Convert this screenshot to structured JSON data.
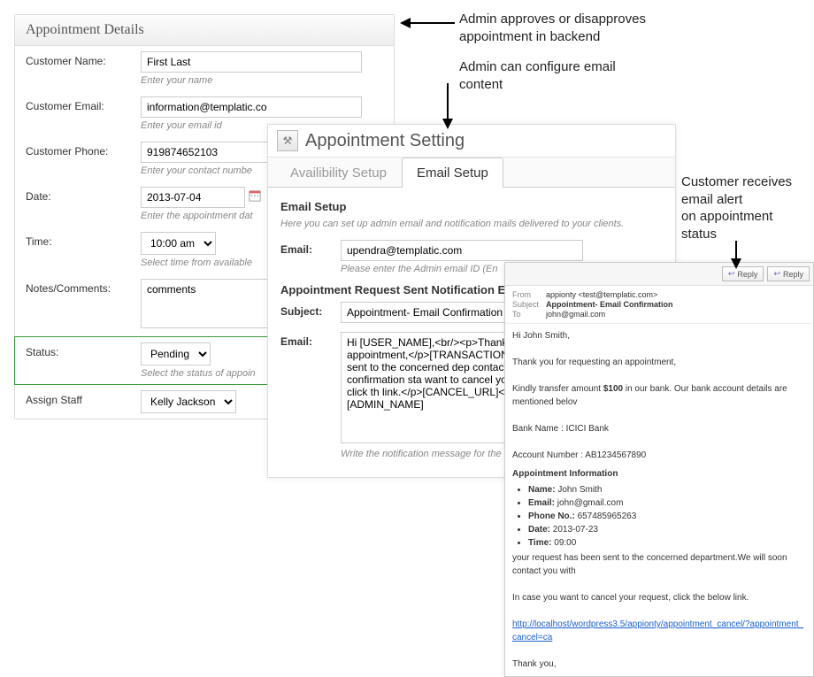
{
  "details": {
    "title": "Appointment Details",
    "customerName": {
      "label": "Customer Name:",
      "value": "First Last",
      "hint": "Enter your name"
    },
    "customerEmail": {
      "label": "Customer Email:",
      "value": "information@templatic.co",
      "hint": "Enter your email id"
    },
    "customerPhone": {
      "label": "Customer Phone:",
      "value": "919874652103",
      "hint": "Enter your contact numbe"
    },
    "date": {
      "label": "Date:",
      "value": "2013-07-04",
      "hint": "Enter the appointment dat"
    },
    "time": {
      "label": "Time:",
      "value": "10:00 am",
      "hint": "Select time from available"
    },
    "notes": {
      "label": "Notes/Comments:",
      "value": "comments"
    },
    "status": {
      "label": "Status:",
      "value": "Pending",
      "hint": "Select the status of appoin"
    },
    "assignStaff": {
      "label": "Assign Staff",
      "value": "Kelly Jackson"
    }
  },
  "settings": {
    "title": "Appointment Setting",
    "tabs": {
      "availability": "Availibility Setup",
      "email": "Email Setup"
    },
    "sectionTitle": "Email Setup",
    "sectionDesc": "Here you can set up admin email and notification mails delivered to your clients.",
    "email": {
      "label": "Email:",
      "value": "upendra@templatic.com",
      "hint": "Please enter the Admin email ID (En"
    },
    "requestHeading": "Appointment Request Sent Notification Email",
    "subject": {
      "label": "Subject:",
      "value": "Appointment- Email Confirmation"
    },
    "body": {
      "label": "Email:",
      "value": "Hi [USER_NAME],<br/><p>Thank yo appointment,</p>[TRANSACTION_D has been sent to the concerned dep contact you with the confirmation sta want to cancel your request, click th link.</p>[CANCEL_URL]<br/><br/>T [ADMIN_NAME]",
      "hint": "Write the notification message for the"
    }
  },
  "emailPreview": {
    "replyBtn": "Reply",
    "from": {
      "k": "From",
      "v": "appionty <test@templatic.com>"
    },
    "subject": {
      "k": "Subject",
      "v": "Appointment- Email Confirmation"
    },
    "to": {
      "k": "To",
      "v": "john@gmail.com"
    },
    "greeting": "Hi John Smith,",
    "l1": "Thank you for requesting an appointment,",
    "l2a": "Kindly transfer amount ",
    "amount": "$100",
    "l2b": " in our bank. Our bank account details are mentioned belov",
    "bank": "Bank Name : ICICI Bank",
    "account": "Account Number : AB1234567890",
    "infoTitle": "Appointment Information",
    "info": {
      "name": {
        "k": "Name:",
        "v": "John Smith"
      },
      "email": {
        "k": "Email:",
        "v": "john@gmail.com"
      },
      "phone": {
        "k": "Phone No.:",
        "v": "657485965263"
      },
      "date": {
        "k": "Date:",
        "v": "2013-07-23"
      },
      "time": {
        "k": "Time:",
        "v": "09:00"
      }
    },
    "l3": "your request has been sent to the concerned department.We will soon contact you with",
    "l4": "In case you want to cancel your request, click the below link.",
    "link": "http://localhost/wordpress3.5/appionty/appointment_cancel/?appointment_cancel=ca",
    "l5": "Thank you,"
  },
  "callouts": {
    "c1a": "Admin approves or disapproves",
    "c1b": "appointment in backend",
    "c2a": "Admin can configure email",
    "c2b": "content",
    "c3a": "Customer receives",
    "c3b": "email alert",
    "c3c": "on appointment",
    "c3d": "status"
  }
}
